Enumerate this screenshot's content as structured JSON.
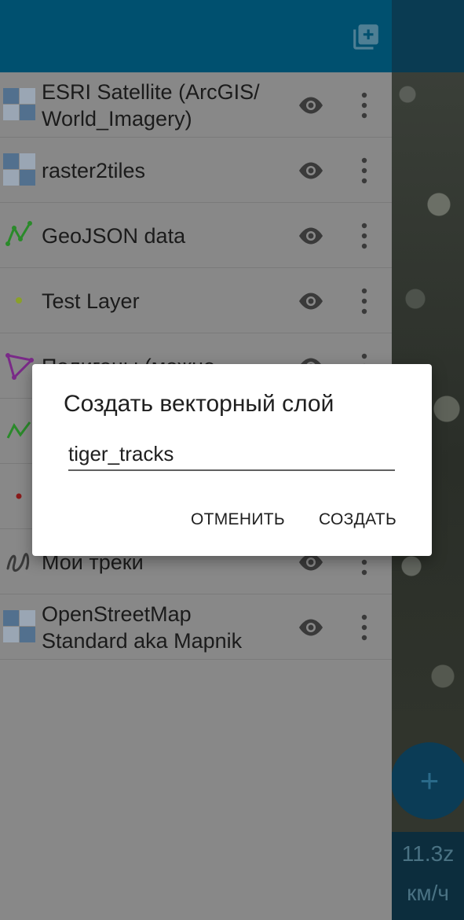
{
  "map": {
    "zoom_text": "11.3z",
    "speed_text": "км/ч",
    "fab_label": "+"
  },
  "drawer": {
    "add_layer_icon": "library-add-icon",
    "layers": [
      {
        "name": "ESRI Satellite (ArcGIS/\nWorld_Imagery)",
        "icon": "raster-tiles-icon"
      },
      {
        "name": "raster2tiles",
        "icon": "raster-tiles-icon"
      },
      {
        "name": "GeoJSON data",
        "icon": "line-layer-icon"
      },
      {
        "name": "Test Layer",
        "icon": "point-layer-icon"
      },
      {
        "name": "Полигоны (можно",
        "icon": "polygon-layer-icon"
      },
      {
        "name": "",
        "icon": "line-layer-icon"
      },
      {
        "name": "",
        "icon": "point-layer-icon"
      },
      {
        "name": "Мои треки",
        "icon": "track-icon"
      },
      {
        "name": "OpenStreetMap\nStandard aka Mapnik",
        "icon": "raster-tiles-icon"
      }
    ]
  },
  "dialog": {
    "title": "Создать векторный слой",
    "input_value": "tiger_tracks",
    "cancel_label": "ОТМЕНИТЬ",
    "create_label": "СОЗДАТЬ"
  },
  "colors": {
    "header": "#00506f",
    "drawer_bg": "#888888",
    "line_icon": "#2a8a2a",
    "point_icon": "#8aa02a",
    "polygon_icon": "#7a2a88",
    "point_red": "#8a1a1a",
    "raster_light": "#9aa6b4",
    "raster_dark": "#52708e"
  }
}
